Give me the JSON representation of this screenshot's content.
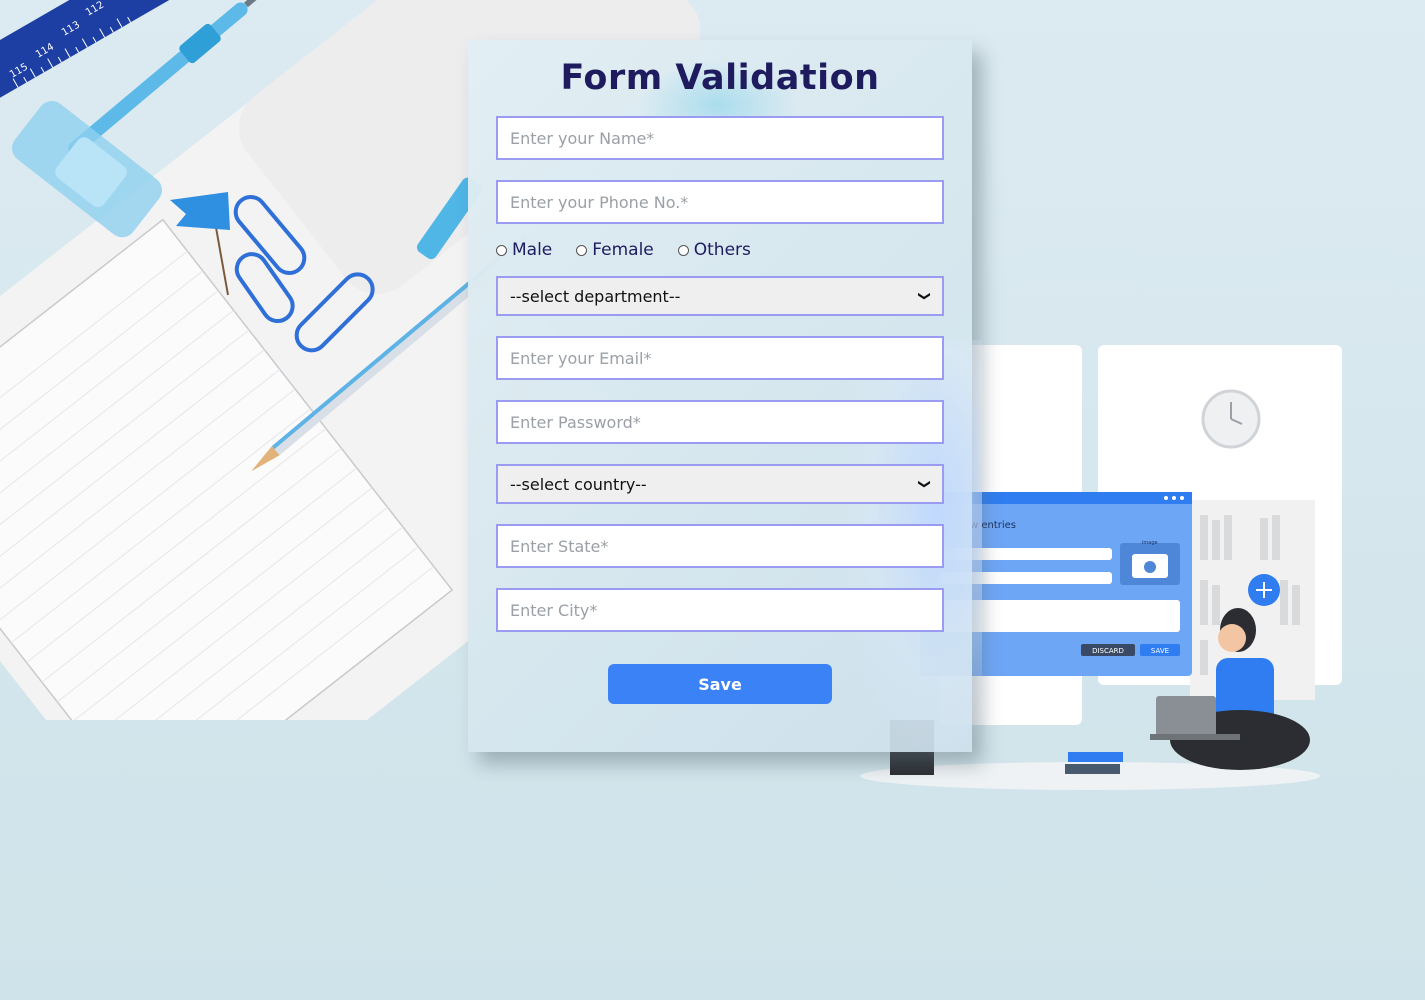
{
  "form": {
    "title": "Form Validation",
    "name_placeholder": "Enter your Name*",
    "phone_placeholder": "Enter your Phone No.*",
    "gender_options": [
      "Male",
      "Female",
      "Others"
    ],
    "department_selected": "--select department--",
    "email_placeholder": "Enter your Email*",
    "password_placeholder": "Enter Password*",
    "country_selected": "--select country--",
    "state_placeholder": "Enter State*",
    "city_placeholder": "Enter City*",
    "save_label": "Save"
  },
  "illustration": {
    "window_title": "w entries",
    "image_label": "image",
    "discard_label": "DISCARD",
    "save_label": "SAVE"
  },
  "ruler": {
    "numbers": [
      "112",
      "113",
      "114",
      "115"
    ]
  },
  "colors": {
    "title": "#1e1b5e",
    "field_border": "#9a9cf2",
    "accent": "#3b82f6"
  }
}
